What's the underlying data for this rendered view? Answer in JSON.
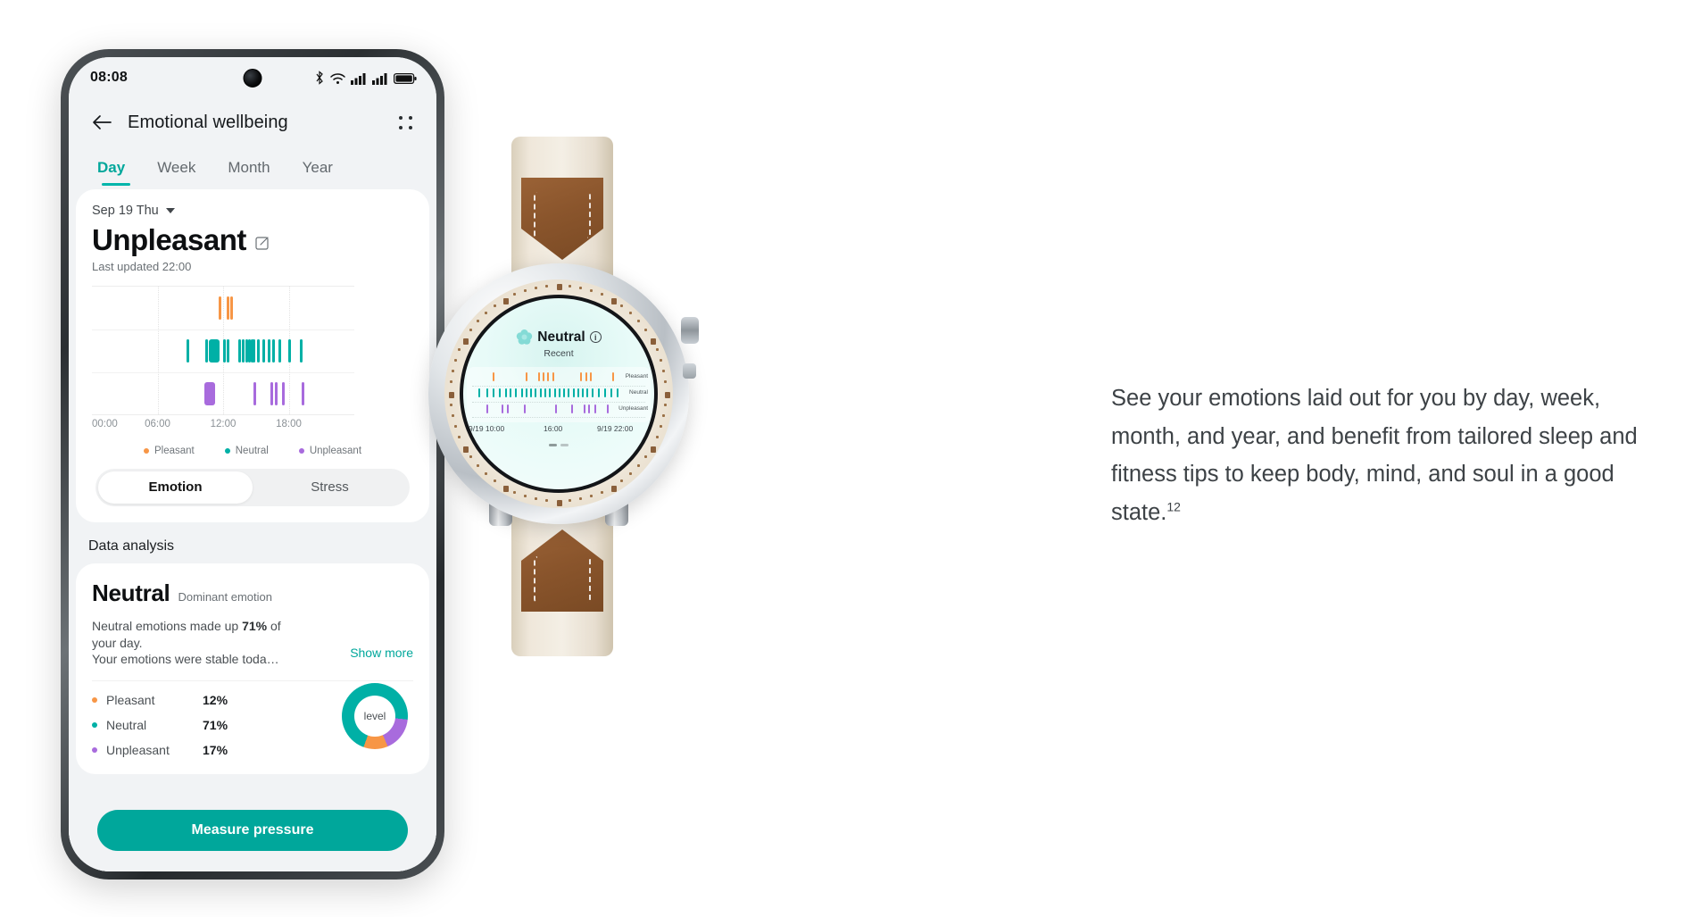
{
  "phone": {
    "status_bar": {
      "clock": "08:08",
      "icons": [
        "bluetooth-icon",
        "wifi-icon",
        "signal-icon",
        "signal-icon-2",
        "battery-icon"
      ]
    },
    "nav": {
      "back_icon": "back-arrow-icon",
      "title": "Emotional wellbeing",
      "menu_icon": "grid-menu-icon"
    },
    "tabs": [
      {
        "label": "Day",
        "active": true
      },
      {
        "label": "Week",
        "active": false
      },
      {
        "label": "Month",
        "active": false
      },
      {
        "label": "Year",
        "active": false
      }
    ],
    "summary": {
      "date": "Sep 19 Thu",
      "date_caret": "chevron-down-icon",
      "mood": "Unpleasant",
      "edit_icon": "edit-note-icon",
      "last_updated": "Last updated 22:00"
    },
    "segmented": [
      {
        "label": "Emotion",
        "active": true
      },
      {
        "label": "Stress",
        "active": false
      }
    ],
    "section_title": "Data analysis",
    "analysis": {
      "dominant_value": "Neutral",
      "dominant_label": "Dominant emotion",
      "paragraph_pre": "Neutral emotions made up ",
      "paragraph_bold": "71%",
      "paragraph_post": " of your day.",
      "paragraph_line2": "Your emotions were stable toda…",
      "show_more": "Show more",
      "donut_center": "level",
      "stats": [
        {
          "label": "Pleasant",
          "value": "12%",
          "color": "#f79646"
        },
        {
          "label": "Neutral",
          "value": "71%",
          "color": "#00b0a6"
        },
        {
          "label": "Unpleasant",
          "value": "17%",
          "color": "#a86bdd"
        }
      ]
    },
    "cta": "Measure pressure"
  },
  "watch": {
    "title": "Neutral",
    "flower_icon": "flower-mood-icon",
    "info_icon": "info-icon",
    "subtitle": "Recent",
    "axis": [
      "9/19 10:00",
      "16:00",
      "9/19 22:00"
    ],
    "row_labels": [
      "Pleasant",
      "Neutral",
      "Unpleasant"
    ],
    "pager": [
      "page-dot-active",
      "page-dot"
    ]
  },
  "marketing": {
    "text": "See your emotions laid out for you by day, week, month, and year, and benefit from tailored sleep and fitness tips to keep body, mind, and soul in a good state.",
    "footnote": "12"
  },
  "colors": {
    "pleasant": "#f79646",
    "neutral": "#00b0a6",
    "unpleasant": "#a86bdd",
    "accent": "#00a79b",
    "cta_bg": "#00a79b"
  },
  "chart_data": {
    "type": "scatter",
    "title": "Emotional wellbeing — Day",
    "xlabel": "",
    "ylabel": "",
    "xlim": [
      0,
      24
    ],
    "grid": true,
    "legend_position": "bottom",
    "tick_labels": [
      "00:00",
      "06:00",
      "12:00",
      "18:00"
    ],
    "tick_hours": [
      0,
      6,
      12,
      18
    ],
    "categories": [
      "Pleasant",
      "Neutral",
      "Unpleasant"
    ],
    "series": [
      {
        "name": "Pleasant",
        "color": "#f79646",
        "row": 0,
        "events_hours": [
          11.6,
          12.35,
          12.62
        ]
      },
      {
        "name": "Neutral",
        "color": "#00b0a6",
        "row": 1,
        "events_hours": [
          8.65,
          10.35,
          10.72,
          12.0,
          12.35,
          13.4,
          13.75,
          14.0,
          14.25,
          14.5,
          14.72,
          15.1,
          15.6,
          16.1,
          16.45,
          17.1,
          17.95,
          19.0
        ]
      },
      {
        "name": "Unpleasant",
        "color": "#a86bdd",
        "row": 2,
        "events_hours": [
          10.3,
          14.8,
          16.3,
          16.7,
          17.4,
          19.2
        ]
      }
    ],
    "summary_percentages": {
      "Pleasant": 12,
      "Neutral": 71,
      "Unpleasant": 17
    }
  },
  "watch_chart_data": {
    "type": "scatter",
    "title": "Neutral — Recent",
    "xlim": [
      "9/19 10:00",
      "9/19 22:00"
    ],
    "tick_labels": [
      "9/19 10:00",
      "16:00",
      "9/19 22:00"
    ],
    "categories": [
      "Pleasant",
      "Neutral",
      "Unpleasant"
    ],
    "series": [
      {
        "name": "Pleasant",
        "color": "#f79646",
        "events_pct": [
          13,
          34,
          42,
          45,
          48,
          51,
          69,
          72,
          75,
          89
        ]
      },
      {
        "name": "Neutral",
        "color": "#00b0a6",
        "events_pct": [
          4,
          9,
          13,
          17,
          21,
          24,
          27,
          31,
          34,
          37,
          40,
          43,
          46,
          49,
          52,
          55,
          58,
          61,
          64,
          67,
          70,
          73,
          76,
          80,
          84,
          88,
          92
        ]
      },
      {
        "name": "Unpleasant",
        "color": "#a86bdd",
        "events_pct": [
          9,
          19,
          22,
          33,
          53,
          63,
          71,
          74,
          78,
          86
        ]
      }
    ]
  }
}
